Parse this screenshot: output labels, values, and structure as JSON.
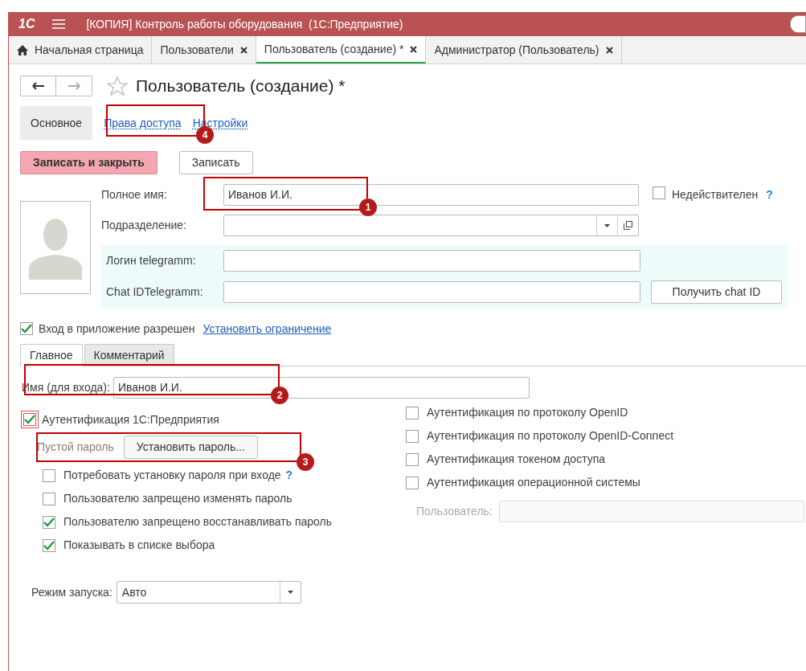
{
  "window": {
    "logo": "1С",
    "title": "[КОПИЯ] Контроль работы оборудования  (1С:Предприятие)"
  },
  "tabs": [
    {
      "label": "Начальная страница",
      "kind": "home",
      "selected": false
    },
    {
      "label": "Пользователи",
      "kind": "closable",
      "selected": false
    },
    {
      "label": "Пользователь (создание) *",
      "kind": "closable",
      "selected": true
    },
    {
      "label": "Администратор (Пользователь)",
      "kind": "closable",
      "selected": false
    }
  ],
  "form": {
    "title": "Пользователь (создание) *",
    "sections": [
      {
        "label": "Основное",
        "selected": true
      },
      {
        "label": "Права доступа",
        "selected": false
      },
      {
        "label": "Настройки",
        "selected": false
      }
    ],
    "buttons": [
      {
        "label": "Записать и закрыть",
        "kind": "primary"
      },
      {
        "label": "Записать",
        "kind": "normal"
      }
    ],
    "full_name": {
      "label": "Полное имя:",
      "value": "Иванов И.И."
    },
    "invalid": {
      "label": "Недействителен",
      "checked": false,
      "help": "?"
    },
    "department": {
      "label": "Подразделение:"
    },
    "telegram_login": {
      "label": "Логин telegramm:"
    },
    "chat_id": {
      "label": "Chat IDTelegramm:",
      "button": "Получить chat ID"
    },
    "login_allowed": {
      "label": "Вход в приложение разрешен",
      "checked": true,
      "link": "Установить ограничение"
    },
    "inner_tabs": [
      {
        "label": "Главное",
        "selected": true
      },
      {
        "label": "Комментарий",
        "selected": false
      }
    ],
    "login_name": {
      "label": "Имя (для входа):",
      "value": "Иванов И.И."
    },
    "auth_1c": {
      "label": "Аутентификация 1С:Предприятия",
      "checked": true,
      "focused": true
    },
    "password": {
      "status": "Пустой пароль",
      "button": "Установить пароль..."
    },
    "password_options": [
      {
        "label": "Потребовать установку пароля при входе",
        "checked": false,
        "help": "?"
      },
      {
        "label": "Пользователю запрещено изменять пароль",
        "checked": false
      },
      {
        "label": "Пользователю запрещено восстанавливать пароль",
        "checked": true
      },
      {
        "label": "Показывать в списке выбора",
        "checked": true
      }
    ],
    "auth_other": [
      {
        "label": "Аутентификация по протоколу OpenID",
        "checked": false
      },
      {
        "label": "Аутентификация по протоколу OpenID-Connect",
        "checked": false
      },
      {
        "label": "Аутентификация токеном доступа",
        "checked": false
      },
      {
        "label": "Аутентификация операционной системы",
        "checked": false
      }
    ],
    "os_user": {
      "label": "Пользователь:",
      "disabled": true
    },
    "launch_mode": {
      "label": "Режим запуска:",
      "value": "Авто"
    }
  },
  "annotations": [
    {
      "number": "4"
    },
    {
      "number": "1"
    },
    {
      "number": "2"
    },
    {
      "number": "3"
    }
  ]
}
